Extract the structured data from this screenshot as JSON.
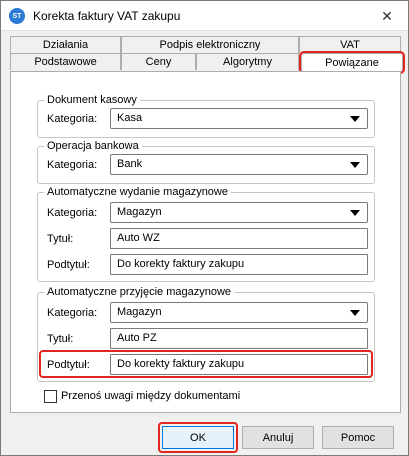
{
  "window": {
    "title": "Korekta faktury VAT zakupu",
    "app_icon_text": "ST",
    "close_glyph": "✕"
  },
  "tabs": {
    "row1": [
      {
        "label": "Działania"
      },
      {
        "label": "Podpis elektroniczny"
      },
      {
        "label": "VAT"
      }
    ],
    "row2": [
      {
        "label": "Podstawowe"
      },
      {
        "label": "Ceny"
      },
      {
        "label": "Algorytmy"
      },
      {
        "label": "Powiązane",
        "active": true
      }
    ]
  },
  "groups": {
    "kasowy": {
      "legend": "Dokument kasowy",
      "kategoria_label": "Kategoria:",
      "kategoria_value": "Kasa"
    },
    "bankowa": {
      "legend": "Operacja bankowa",
      "kategoria_label": "Kategoria:",
      "kategoria_value": "Bank"
    },
    "wydanie": {
      "legend": "Automatyczne wydanie magazynowe",
      "kategoria_label": "Kategoria:",
      "kategoria_value": "Magazyn",
      "tytul_label": "Tytuł:",
      "tytul_value": "Auto WZ",
      "podtytul_label": "Podtytuł:",
      "podtytul_value": "Do korekty faktury zakupu"
    },
    "przyjecie": {
      "legend": "Automatyczne przyjęcie magazynowe",
      "kategoria_label": "Kategoria:",
      "kategoria_value": "Magazyn",
      "tytul_label": "Tytuł:",
      "tytul_value": "Auto PZ",
      "podtytul_label": "Podtytuł:",
      "podtytul_value": "Do korekty faktury zakupu"
    }
  },
  "checkbox": {
    "label": "Przenoś uwagi między dokumentami",
    "checked": false
  },
  "buttons": {
    "ok": "OK",
    "cancel": "Anuluj",
    "help": "Pomoc"
  },
  "colors": {
    "highlight": "#e0261f",
    "default_button_border": "#0078d7"
  }
}
